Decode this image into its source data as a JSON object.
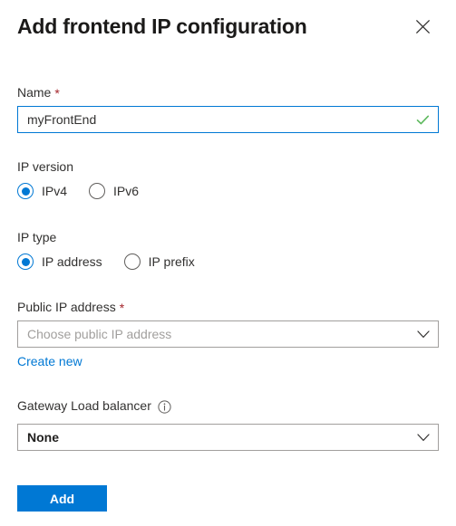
{
  "panel": {
    "title": "Add frontend IP configuration",
    "close_icon": "close-icon"
  },
  "form": {
    "name_field": {
      "label": "Name",
      "required_marker": "*",
      "value": "myFrontEnd",
      "placeholder": "",
      "validation_icon": "checkmark-icon"
    },
    "ip_version": {
      "label": "IP version",
      "options": [
        {
          "label": "IPv4",
          "selected": true
        },
        {
          "label": "IPv6",
          "selected": false
        }
      ]
    },
    "ip_type": {
      "label": "IP type",
      "options": [
        {
          "label": "IP address",
          "selected": true
        },
        {
          "label": "IP prefix",
          "selected": false
        }
      ]
    },
    "public_ip_address": {
      "label": "Public IP address",
      "required_marker": "*",
      "value": "",
      "placeholder": "Choose public IP address",
      "chevron_icon": "chevron-down-icon",
      "create_new_link": "Create new"
    },
    "gateway_load_balancer": {
      "label": "Gateway Load balancer",
      "info_icon": "info-icon",
      "value": "None",
      "chevron_icon": "chevron-down-icon"
    }
  },
  "footer": {
    "add_label": "Add"
  },
  "colors": {
    "accent": "#0078d4",
    "required": "#a4262c",
    "success": "#5cb85c",
    "border": "#a19f9d",
    "text": "#323130",
    "placeholder": "#a19f9d"
  }
}
